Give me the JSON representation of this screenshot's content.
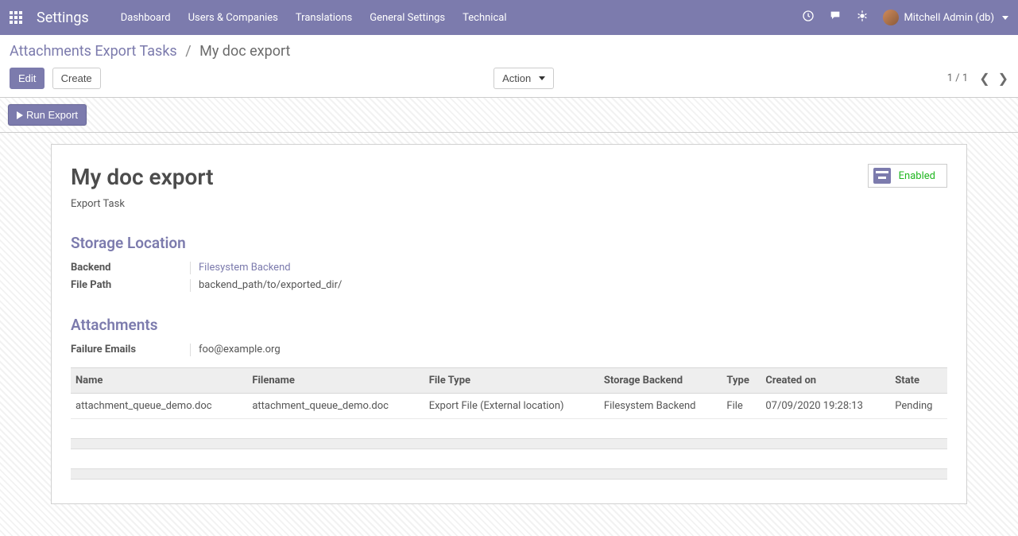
{
  "nav": {
    "brand": "Settings",
    "items": [
      "Dashboard",
      "Users & Companies",
      "Translations",
      "General Settings",
      "Technical"
    ],
    "user": "Mitchell Admin (db)"
  },
  "breadcrumb": {
    "parent": "Attachments Export Tasks",
    "current": "My doc export"
  },
  "cp": {
    "edit": "Edit",
    "create": "Create",
    "action": "Action",
    "pager": "1 / 1"
  },
  "statusbar": {
    "run": "Run Export"
  },
  "record": {
    "title": "My doc export",
    "subtitle": "Export Task",
    "status_label": "Enabled"
  },
  "storage": {
    "section_title": "Storage Location",
    "backend_label": "Backend",
    "backend_value": "Filesystem Backend",
    "filepath_label": "File Path",
    "filepath_value": "backend_path/to/exported_dir/"
  },
  "attachments": {
    "section_title": "Attachments",
    "failure_label": "Failure Emails",
    "failure_value": "foo@example.org",
    "columns": [
      "Name",
      "Filename",
      "File Type",
      "Storage Backend",
      "Type",
      "Created on",
      "State"
    ],
    "rows": [
      {
        "name": "attachment_queue_demo.doc",
        "filename": "attachment_queue_demo.doc",
        "filetype": "Export File (External location)",
        "backend": "Filesystem Backend",
        "type": "File",
        "created": "07/09/2020 19:28:13",
        "state": "Pending"
      }
    ]
  }
}
